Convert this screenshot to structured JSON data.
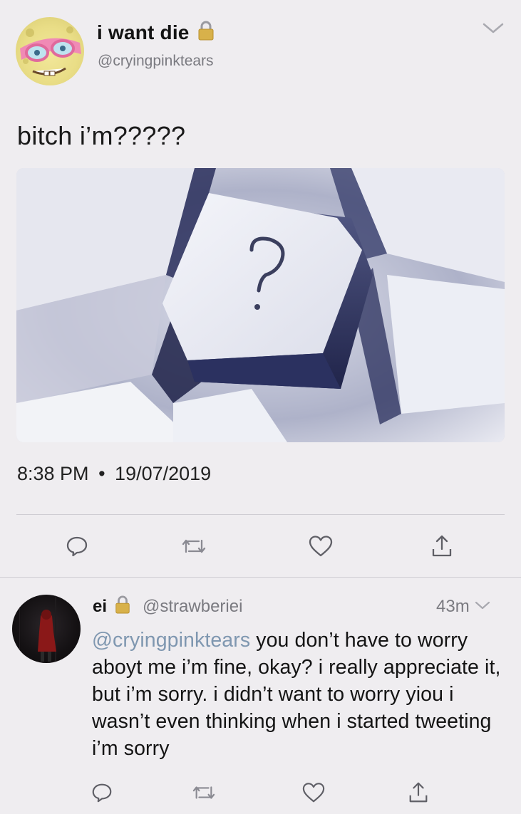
{
  "main_tweet": {
    "display_name": "i want die",
    "handle": "@cryingpinktears",
    "text": "bitch i’m?????",
    "timestamp": "8:38 PM",
    "separator": "•",
    "date": "19/07/2019",
    "media_description": "keyboard-question-key"
  },
  "reply": {
    "display_name": "ei",
    "handle": "@strawberiei",
    "age": "43m",
    "mention": "@cryingpinktears",
    "text": " you don’t have to worry aboyt me i’m fine, okay? i really appreciate it, but i’m sorry. i didn’t want to worry yiou i wasn’t even thinking when i started tweeting i’m sorry"
  },
  "icons": {
    "reply": "reply-icon",
    "retweet": "retweet-icon",
    "like": "heart-icon",
    "share": "share-icon",
    "lock": "lock-icon",
    "menu": "chevron-down-icon"
  },
  "colors": {
    "background": "#efedf0",
    "text": "#141414",
    "muted": "#7a7a80",
    "mention": "#7f97b0",
    "icon": "#5f5f66"
  }
}
